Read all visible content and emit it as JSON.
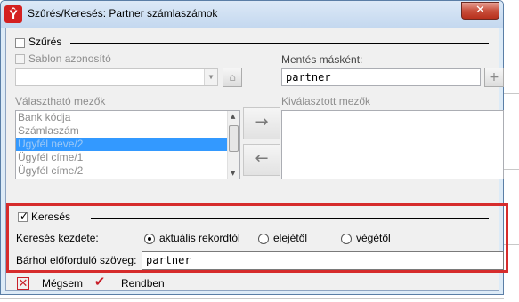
{
  "window": {
    "title": "Szűrés/Keresés: Partner számlaszámok",
    "close_label": "✕"
  },
  "filter_section": {
    "label": "Szűrés",
    "checked": false,
    "template_label": "Sablon azonosító",
    "template_value": "",
    "save_as_label": "Mentés másként:",
    "save_as_value": "partner",
    "add_label": "+",
    "available_fields_label": "Választható mezők",
    "selected_fields_label": "Kiválasztott mezők",
    "available_fields": [
      "Bank kódja",
      "Számlaszám",
      "Ügyfél neve/2",
      "Ügyfél címe/1",
      "Ügyfél címe/2"
    ],
    "selected_index": 2,
    "add_field_arrow": "→",
    "remove_field_arrow": "←"
  },
  "search_section": {
    "label": "Keresés",
    "checked": true,
    "start_label": "Keresés kezdete:",
    "options": [
      {
        "label": "aktuális rekordtól",
        "selected": true
      },
      {
        "label": "elejétől",
        "selected": false
      },
      {
        "label": "végétől",
        "selected": false
      }
    ],
    "text_label": "Bárhol előforduló szöveg:",
    "text_value": "partner"
  },
  "footer": {
    "cancel_label": "Mégsem",
    "ok_label": "Rendben"
  },
  "colors": {
    "highlight": "#d62c2c",
    "selection": "#3399ff"
  }
}
